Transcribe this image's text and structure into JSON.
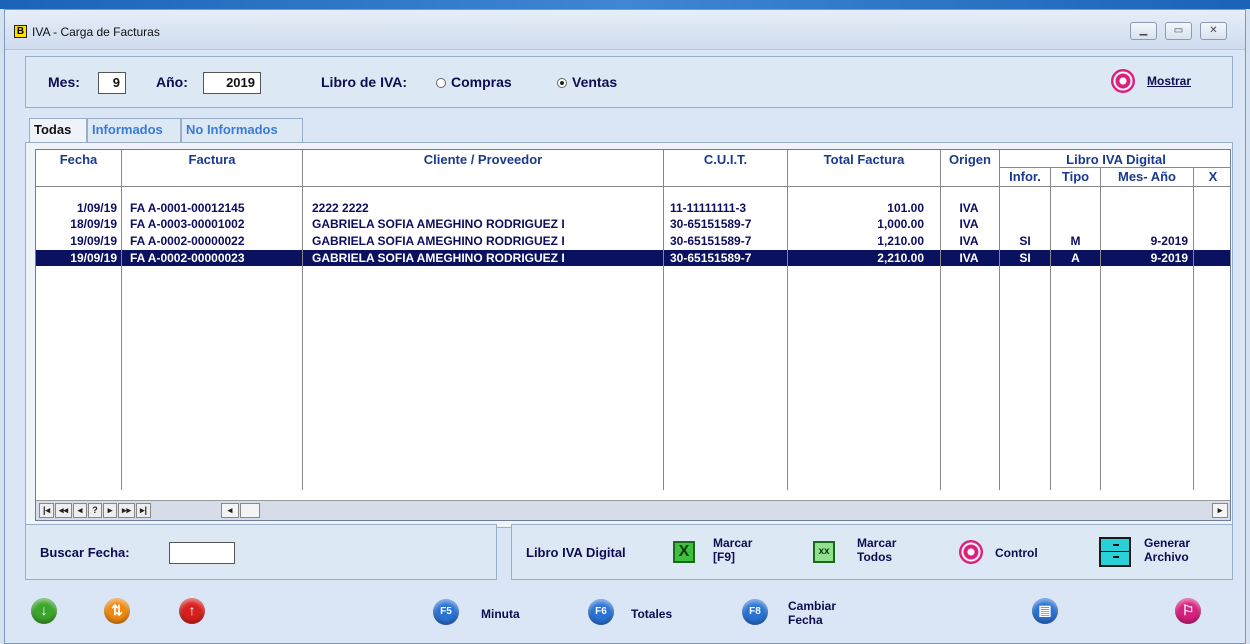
{
  "window": {
    "title": "IVA - Carga de Facturas",
    "icon_letter": "B"
  },
  "filters": {
    "mes_label": "Mes:",
    "mes_value": "9",
    "anio_label": "Año:",
    "anio_value": "2019",
    "libro_label": "Libro de IVA:",
    "option_compras": "Compras",
    "option_ventas": "Ventas",
    "selected": "Ventas",
    "mostrar_label": "Mostrar"
  },
  "tabs": [
    {
      "label": "Todas",
      "active": true
    },
    {
      "label": "Informados",
      "active": false
    },
    {
      "label": "No Informados",
      "active": false
    }
  ],
  "table": {
    "headers": [
      "Fecha",
      "Factura",
      "Cliente / Proveedor",
      "C.U.I.T.",
      "Total Factura",
      "Origen"
    ],
    "group_header": "Libro IVA Digital",
    "sub_headers": [
      "Infor.",
      "Tipo",
      "Mes- Año",
      "X"
    ],
    "rows": [
      {
        "fecha": "1/09/19",
        "factura": "FA A-0001-00012145",
        "cliente": "2222 2222",
        "cuit": "11-11111111-3",
        "total": "101.00",
        "origen": "IVA",
        "infor": "",
        "tipo": "",
        "mes_anio": "",
        "x": "",
        "selected": false
      },
      {
        "fecha": "18/09/19",
        "factura": "FA A-0003-00001002",
        "cliente": "GABRIELA SOFIA AMEGHINO RODRIGUEZ I",
        "cuit": "30-65151589-7",
        "total": "1,000.00",
        "origen": "IVA",
        "infor": "",
        "tipo": "",
        "mes_anio": "",
        "x": "",
        "selected": false
      },
      {
        "fecha": "19/09/19",
        "factura": "FA A-0002-00000022",
        "cliente": "GABRIELA SOFIA AMEGHINO RODRIGUEZ I",
        "cuit": "30-65151589-7",
        "total": "1,210.00",
        "origen": "IVA",
        "infor": "SI",
        "tipo": "M",
        "mes_anio": "9-2019",
        "x": "",
        "selected": false
      },
      {
        "fecha": "19/09/19",
        "factura": "FA A-0002-00000023",
        "cliente": "GABRIELA SOFIA AMEGHINO RODRIGUEZ I",
        "cuit": "30-65151589-7",
        "total": "2,210.00",
        "origen": "IVA",
        "infor": "SI",
        "tipo": "A",
        "mes_anio": "9-2019",
        "x": "",
        "selected": true
      }
    ],
    "nav_buttons": [
      "|◂",
      "◂◂",
      "◂",
      "?",
      "▸",
      "▸▸",
      "▸|"
    ]
  },
  "buscar": {
    "label": "Buscar Fecha:",
    "value": ""
  },
  "libro_digital": {
    "label": "Libro IVA Digital",
    "marcar": [
      "Marcar",
      "[F9]"
    ],
    "marcar_todos": [
      "Marcar",
      "Todos"
    ],
    "control": "Control",
    "generar": [
      "Generar",
      "Archivo"
    ]
  },
  "bottom": {
    "minuta": {
      "key": "F5",
      "label": "Minuta"
    },
    "totales": {
      "key": "F6",
      "label": "Totales"
    },
    "cambiar": {
      "key": "F8",
      "label": [
        "Cambiar",
        "Fecha"
      ]
    }
  },
  "colors": {
    "selected_row": "#0a1260",
    "fkey_blue": "#2a73d6",
    "green": "#3aa52a",
    "orange": "#f08a10",
    "red": "#d8201e",
    "pink": "#d8207e"
  }
}
